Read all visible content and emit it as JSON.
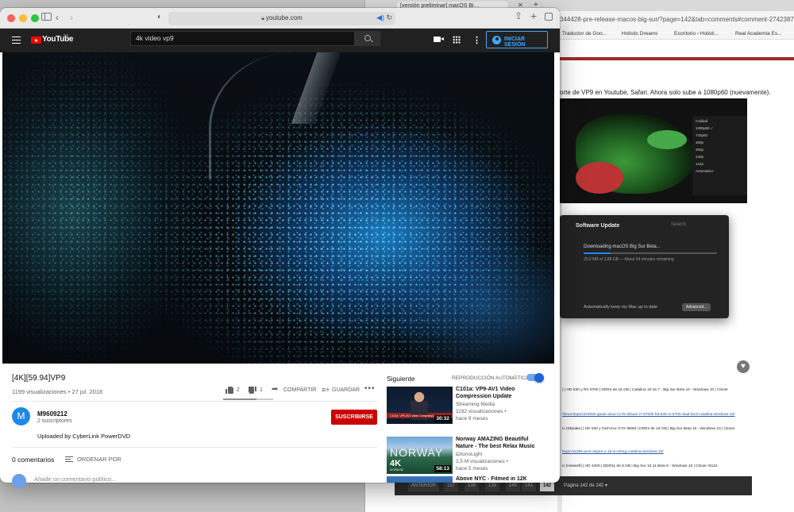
{
  "back_window": {
    "tab_title": "[versión preliminar] macOS Bi…",
    "url": "344428-pre-release-macos-big-sur/?page=142&tab=comments#comment-2742387",
    "bookmarks": [
      "Traductor de Goo...",
      "Holistic Dreams",
      "Escritorio ‹ Holisti...",
      "Real Academia Es..."
    ],
    "post_text": "orte de VP9 en Youtube, Safari. Ahora solo sube a 1080p60 (nuevamente).",
    "quality_menu": {
      "header": "Calidad",
      "options": [
        "1080p60 ✓",
        "720p60",
        "480p",
        "360p",
        "240p",
        "144p",
        "Automático"
      ]
    },
    "software_update": {
      "title": "Software Update",
      "search": "Search",
      "heading": "Downloading macOS Big Sur Beta...",
      "progress_fraction": 0.2,
      "subtext": "25,8 MB of 3,88 GB — About 54 minutes remaining",
      "auto_update": "Automatically keep my Mac up to date",
      "advanced": "Advanced..."
    },
    "heart_icon": "heart-icon",
    "spec_lines": [
      {
        "text": ") | HD 530 y RX 5700 | DDR4 de 16 GB | Catalina 10.15.7 - Big Sur Beta 10 - Windows 10 | Clover",
        "link": false
      },
      {
        "text": "/forum/topic/342082-guide-asus-z170-deluxe-i7-6700k-hd-530-rx-5700-dual-boot-catalina-windows-10/",
        "link": true
      },
      {
        "text": "U (Skylake) | HD 530 y GeForce GTX 950M | DDR4 de 16 GB | Big Sur Beta 10 - Windows 10 | Clover",
        "link": false
      },
      {
        "text": "/topic/11355-acer-aspire-v-15-vn-591g-catalina-windows-10/",
        "link": true
      },
      {
        "text": "U (Haswell) | HD 4400 | DDR3L de 8 GB | Big Sur 10.11 Beta 9 - Windows 10 | Clover r5124",
        "link": false
      }
    ],
    "pagination": {
      "prev": "ANTERIOR",
      "pages": [
        "137",
        "138",
        "139",
        "140",
        "141",
        "142"
      ],
      "current": "142",
      "label": "Página 142 de 142 ▾"
    }
  },
  "browser": {
    "url": "youtube.com",
    "icons": [
      "sidebar-icon",
      "back-icon",
      "forward-icon",
      "shield-icon",
      "lock-icon",
      "speaker-icon",
      "reload-icon",
      "share-icon",
      "plus-icon",
      "tabs-icon"
    ]
  },
  "youtube": {
    "logo_text": "YouTube",
    "country_code": "ES",
    "search_query": "4k video vp9",
    "signin_label": "INICIAR SESIÓN",
    "video": {
      "title": "[4K][59.94]VP9",
      "meta": "1199 visualizaciones • 27 jul. 2018",
      "likes": "2",
      "dislikes": "1",
      "like_ratio": 0.67,
      "share": "COMPARTIR",
      "save": "GUARDAR",
      "more": "•••"
    },
    "channel": {
      "avatar_letter": "M",
      "name": "M9609212",
      "subscribers": "2 suscriptores",
      "subscribe": "SUSCRIBIRSE",
      "description": "Uploaded by CyberLink PowerDVD"
    },
    "comments": {
      "count": "0 comentarios",
      "sort": "ORDENAR POR",
      "placeholder": "Añade un comentario público..."
    },
    "sidebar": {
      "next_label": "Siguiente",
      "autoplay_label": "REPRODUCCIÓN AUTOMÁTICA",
      "autoplay_on": true,
      "recommendations": [
        {
          "title": "C101a: VP9-AV1 Video Compression Update",
          "channel": "Streaming Media",
          "views": "1192 visualizaciones •",
          "age": "hace 9 meses",
          "duration": "30:32",
          "thumb_caption": "C101a: VP9-AV1 Video Compression Update"
        },
        {
          "title": "Norway AMAZING Beautiful Nature - The best Relax Music _",
          "channel": "ChonoLight",
          "views": "2,5 M visualizaciones •",
          "age": "hace 5 meses",
          "duration": "58:13",
          "thumb_text": "NORWAY",
          "thumb_badge": "4K",
          "thumb_badge_sub": "ULTRA HD"
        },
        {
          "title": "Above NYC - Filmed in 12K",
          "channel": "",
          "views": "",
          "age": "",
          "duration": ""
        }
      ]
    }
  }
}
